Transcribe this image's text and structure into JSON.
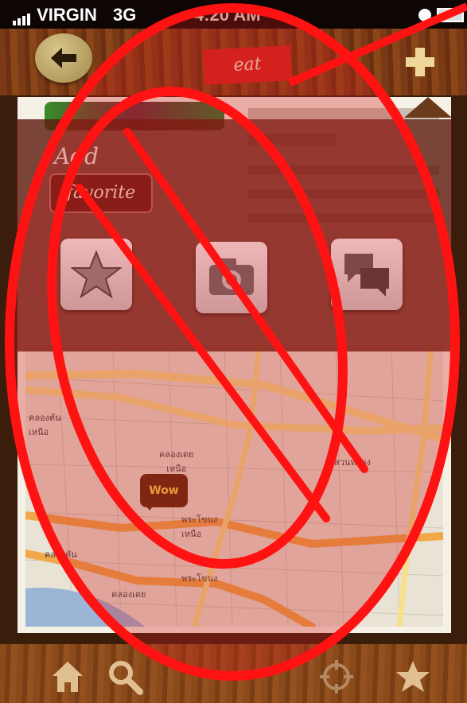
{
  "status_bar": {
    "carrier": "VIRGIN",
    "network": "3G",
    "time": "4:20 AM"
  },
  "header": {
    "title": "eat",
    "back_icon": "back-arrow-icon",
    "add_icon": "plus-icon"
  },
  "popup": {
    "heading": "Add",
    "selected": "favorite",
    "actions": [
      {
        "name": "favorite",
        "icon": "star-icon"
      },
      {
        "name": "photo",
        "icon": "camera-icon"
      },
      {
        "name": "comment",
        "icon": "speech-bubble-icon"
      }
    ]
  },
  "map": {
    "pin_label": "Wow",
    "labels": {
      "district_north": "คลองเตย\nเหนือ",
      "district_left": "คลองตัน\nเหนือ",
      "prakhanong": "พระโขนง\nเหนือ",
      "klongtan": "คลองตัน",
      "klongtoey": "คลองเตย",
      "suanluang": "สวนหลวง",
      "prakhanong_south": "พระโขนง"
    }
  },
  "tab_bar": [
    {
      "name": "home",
      "icon": "home-icon"
    },
    {
      "name": "search",
      "icon": "search-icon"
    },
    {
      "name": "locate",
      "icon": "crosshair-icon"
    },
    {
      "name": "favorites",
      "icon": "star-icon"
    }
  ],
  "colors": {
    "overlay_red": "#e01818",
    "popup_bg": "#5c190c",
    "header_wood": "#7a3a16"
  }
}
